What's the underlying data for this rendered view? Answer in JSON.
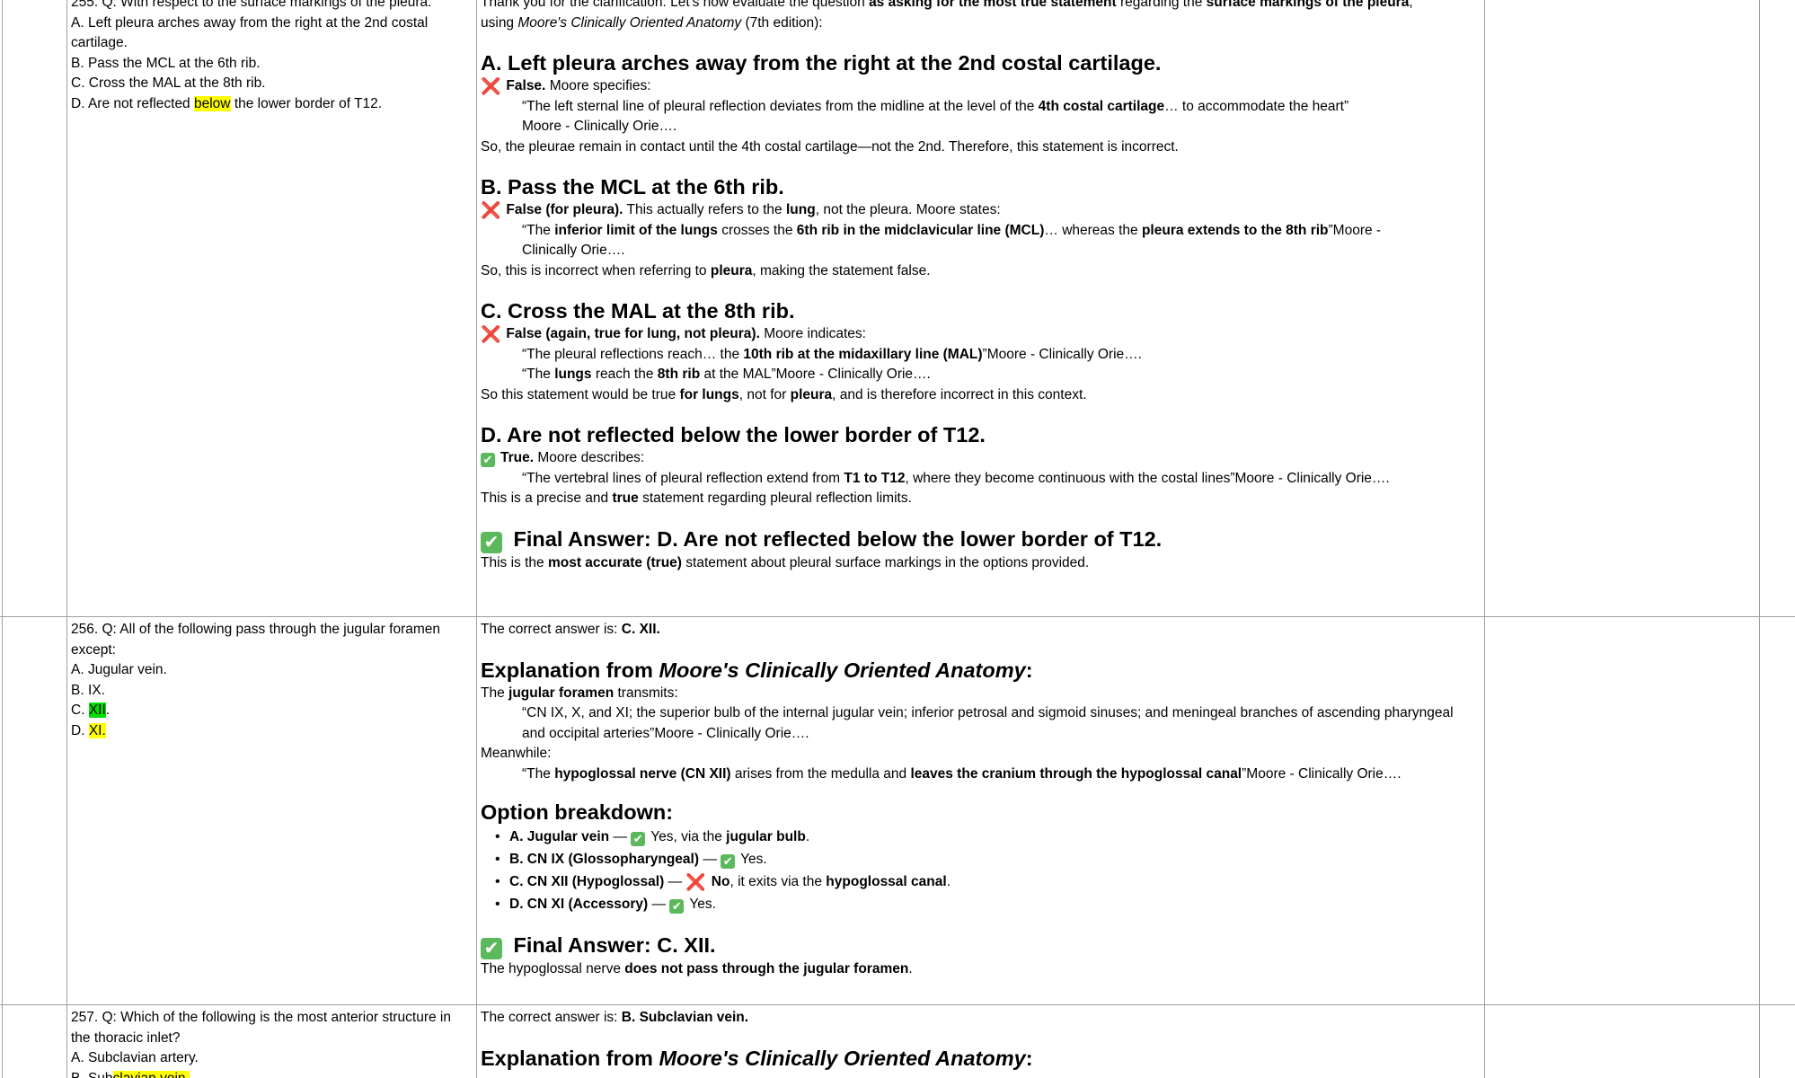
{
  "q255": {
    "stem": "255. Q: With respect to the surface markings of the pleura:",
    "a": "A. Left pleura arches away from the right at the 2nd costal cartilage.",
    "b": "B. Pass the MCL at the 6th rib.",
    "c": "C. Cross the MAL at the 8th rib.",
    "d_pre": "D. Are not reflected",
    "d_hl": "below",
    "d_post": "the lower border of T12."
  },
  "a255": {
    "intro_1": "Thank you for the clarification. Let's now evaluate the question",
    "intro_b1": "as asking for the most true statement",
    "intro_2": "regarding the",
    "intro_b2": "surface markings of the pleura",
    "intro_3": ",",
    "intro_4": "using",
    "intro_book": "Moore's Clinically Oriented Anatomy",
    "intro_5": "(7th edition):",
    "hA": "A. Left pleura arches away from the right at the 2nd costal cartilage.",
    "A_verdict": "False.",
    "A_verdict_rest": "Moore specifies:",
    "A_quote_1": "“The left sternal line of pleural reflection deviates from the midline at the level of the",
    "A_quote_b": "4th costal cartilage",
    "A_quote_2": "… to accommodate the heart”",
    "A_cite": "Moore - Clinically Orie….",
    "A_note": "So, the pleurae remain in contact until the 4th costal cartilage—not the 2nd. Therefore, this statement is incorrect.",
    "hB": "B. Pass the MCL at the 6th rib.",
    "B_verdict": "False (for pleura).",
    "B_v2": "This actually refers to the",
    "B_vb": "lung",
    "B_v3": ", not the pleura. Moore states:",
    "B_q1": "“The",
    "B_qb1": "inferior limit of the lungs",
    "B_q2": "crosses the",
    "B_qb2": "6th rib in the midclavicular line (MCL)",
    "B_q3": "… whereas the",
    "B_qb3": "pleura extends to the 8th rib",
    "B_q4": "”Moore - Clinically Orie….",
    "B_note_1": "So, this is incorrect when referring to",
    "B_note_b": "pleura",
    "B_note_2": ", making the statement false.",
    "hC": "C. Cross the MAL at the 8th rib.",
    "C_verdict": "False (again, true for lung, not pleura).",
    "C_v2": "Moore indicates:",
    "C_q1a": "“The pleural reflections reach… the",
    "C_q1b": "10th rib at the midaxillary line (MAL)",
    "C_q1c": "”Moore - Clinically Orie….",
    "C_q2a": "“The",
    "C_q2b": "lungs",
    "C_q2c": "reach the",
    "C_q2d": "8th rib",
    "C_q2e": "at the MAL”Moore - Clinically Orie….",
    "C_note_1": "So this statement would be true",
    "C_note_b1": "for lungs",
    "C_note_2": ", not for",
    "C_note_b2": "pleura",
    "C_note_3": ", and is therefore incorrect in this context.",
    "hD": "D. Are not reflected below the lower border of T12.",
    "D_verdict": "True.",
    "D_v2": "Moore describes:",
    "D_q1": "“The vertebral lines of pleural reflection extend from",
    "D_qb": "T1 to T12",
    "D_q2": ", where they become continuous with the costal lines”Moore - Clinically Orie….",
    "D_note_1": "This is a precise and",
    "D_note_b": "true",
    "D_note_2": "statement regarding pleural reflection limits.",
    "final": "Final Answer: D. Are not reflected below the lower border of T12.",
    "final_1": "This is the",
    "final_b": "most accurate (true)",
    "final_2": "statement about pleural surface markings in the options provided."
  },
  "q256": {
    "stem": "256. Q: All of the following pass through the jugular foramen except:",
    "a": "A. Jugular vein.",
    "b": "B. IX.",
    "c_pre": "C.",
    "c_hl": "XII",
    "c_post": ".",
    "d_pre": "D.",
    "d_hl": "XI."
  },
  "a256": {
    "correct_1": "The correct answer is:",
    "correct_b": "C. XII.",
    "exp_1": "Explanation from",
    "exp_book": "Moore's Clinically Oriented Anatomy",
    "exp_2": ":",
    "t1": "The",
    "tb": "jugular foramen",
    "t2": "transmits:",
    "q1": "“CN IX, X, and XI; the superior bulb of the internal jugular vein; inferior petrosal and sigmoid sinuses; and meningeal branches of ascending pharyngeal and occipital arteries”Moore - Clinically Orie….",
    "meanwhile": "Meanwhile:",
    "q2a": "“The",
    "q2b": "hypoglossal nerve (CN XII)",
    "q2c": "arises from the medulla and",
    "q2d": "leaves the cranium through the hypoglossal canal",
    "q2e": "”Moore - Clinically Orie….",
    "breakdown": "Option breakdown:",
    "oA_b": "A. Jugular vein",
    "oA_1": "Yes, via the",
    "oA_b2": "jugular bulb",
    "oA_2": ".",
    "oB_b": "B. CN IX (Glossopharyngeal)",
    "oB_1": "Yes.",
    "oC_b": "C. CN XII (Hypoglossal)",
    "oC_b1": "No",
    "oC_1": ", it exits via the",
    "oC_b2": "hypoglossal canal",
    "oC_2": ".",
    "oD_b": "D. CN XI (Accessory)",
    "oD_1": "Yes.",
    "dash": "—",
    "final": "Final Answer: C. XII.",
    "fin_1": "The hypoglossal nerve",
    "fin_b": "does not pass through the jugular foramen",
    "fin_2": "."
  },
  "q257": {
    "stem": "257. Q: Which of the following is the most anterior structure in the thoracic inlet?",
    "a": "A. Subclavian artery.",
    "b_pre": "B. Sub",
    "b_hl": "clavian vein."
  },
  "a257": {
    "correct_1": "The correct answer is:",
    "correct_b": "B. Subclavian vein.",
    "exp_1": "Explanation from",
    "exp_book": "Moore's Clinically Oriented Anatomy",
    "exp_2": ":"
  },
  "icons": {
    "cross": "❌",
    "check": "✔"
  },
  "colors": {
    "gridline": "#9e9e9e",
    "highlight_yellow": "#ffff00",
    "highlight_green": "#00e000",
    "check_green": "#5cb85c",
    "cross_red": "#e0245e"
  }
}
